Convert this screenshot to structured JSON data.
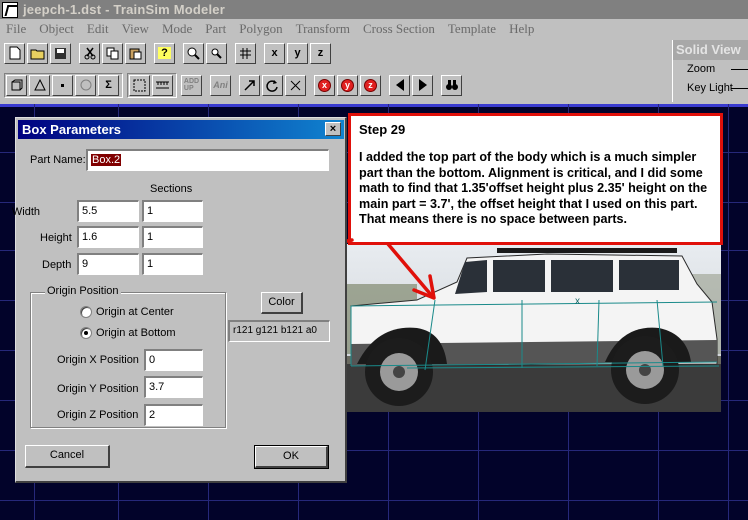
{
  "window": {
    "title": "jeepch-1.dst - TrainSim Modeler"
  },
  "menubar": {
    "items": [
      "File",
      "Object",
      "Edit",
      "View",
      "Mode",
      "Part",
      "Polygon",
      "Transform",
      "Cross Section",
      "Template",
      "Help"
    ]
  },
  "toolbar2": {
    "add_label": "ADD\nUP",
    "ani_label": "Ani"
  },
  "solid_panel": {
    "title": "Solid View",
    "zoom_label": "Zoom",
    "keylight_label": "Key Light"
  },
  "dialog": {
    "title": "Box Parameters",
    "close_label": "×",
    "part_name_label": "Part Name:",
    "part_name_value": "Box.2",
    "sections_label": "Sections",
    "width_label": "Width",
    "width_value": "5.5",
    "width_sections": "1",
    "height_label": "Height",
    "height_value": "1.6",
    "height_sections": "1",
    "depth_label": "Depth",
    "depth_value": "9",
    "depth_sections": "1",
    "origin_group_label": "Origin Position",
    "origin_center_label": "Origin at Center",
    "origin_bottom_label": "Origin at Bottom",
    "origin_selected": "bottom",
    "origin_x_label": "Origin X Position",
    "origin_x_value": "0",
    "origin_y_label": "Origin Y Position",
    "origin_y_value": "3.7",
    "origin_z_label": "Origin Z Position",
    "origin_z_value": "2",
    "color_button_label": "Color",
    "color_value": "r121 g121 b121 a0",
    "cancel_label": "Cancel",
    "ok_label": "OK"
  },
  "annotation": {
    "step_title": "Step 29",
    "step_text": "I added the top part of the body which is a much simpler part than the bottom. Alignment is critical, and I did some math to find that 1.35'offset height plus 2.35' height on the main part = 3.7', the offset height that I used on this part. That means there is no space between parts.",
    "arrow_color": "#e0100a"
  },
  "colors": {
    "viewport_bg": "#02032a",
    "grid": "#26287a",
    "dialog_title_start": "#000080",
    "dialog_title_end": "#1084d0",
    "part_name_highlight": "#800000"
  }
}
